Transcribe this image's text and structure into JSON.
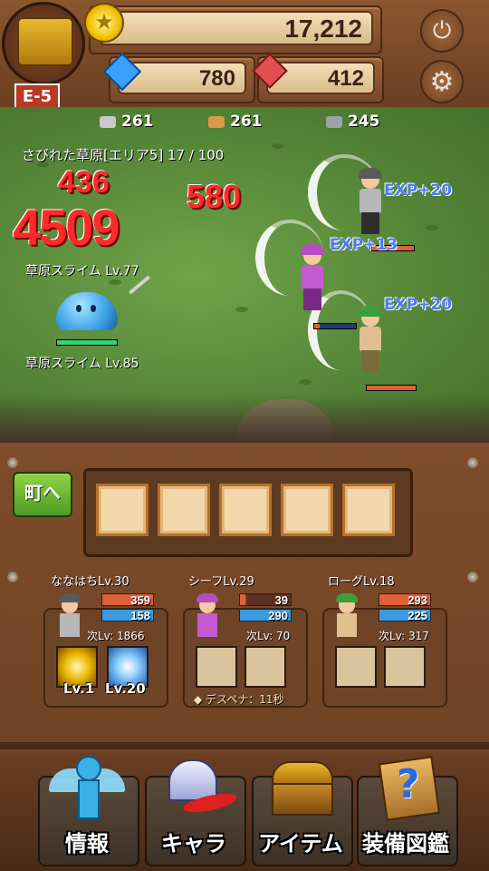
{
  "currency": {
    "gold": "17,212",
    "blue_gem": "780",
    "red_gem": "412"
  },
  "stage": {
    "code": "E-5"
  },
  "materials": [
    {
      "icon": "stone-material-icon",
      "count": "261",
      "color": "#c9c9c9"
    },
    {
      "icon": "wood-material-icon",
      "count": "261",
      "color": "#d99a4a"
    },
    {
      "icon": "ore-material-icon",
      "count": "245",
      "color": "#9aa3a8"
    }
  ],
  "area": {
    "progress_text": "さびれた草原[エリア5] 17 / 100"
  },
  "battle": {
    "damage_numbers": [
      "436",
      "4509",
      "580"
    ],
    "exp_gains": [
      "EXP+20",
      "EXP+13",
      "EXP+20"
    ],
    "enemies": [
      {
        "label": "草原スライム Lv.77"
      },
      {
        "label": "草原スライム Lv.85"
      }
    ]
  },
  "town_button": {
    "label": "町へ"
  },
  "party": [
    {
      "name": "ななはちLv.30",
      "hp": "359",
      "mp": "158",
      "hp_fill": 1.0,
      "next": "次Lv: 1866",
      "skills": [
        {
          "level": "Lv.1"
        },
        {
          "level": "Lv.20"
        }
      ]
    },
    {
      "name": "シーフLv.29",
      "hp": "39",
      "mp": "290",
      "hp_fill": 0.12,
      "next": "次Lv: 70",
      "status": "デスペナ：11秒"
    },
    {
      "name": "ローグLv.18",
      "hp": "293",
      "mp": "225",
      "hp_fill": 1.0,
      "next": "次Lv: 317"
    }
  ],
  "nav": [
    {
      "label": "情報",
      "icon": "info-angel-icon"
    },
    {
      "label": "キャラ",
      "icon": "helmet-feather-icon"
    },
    {
      "label": "アイテム",
      "icon": "treasure-chest-icon"
    },
    {
      "label": "装備図鑑",
      "icon": "question-book-icon"
    }
  ],
  "colors": {
    "hp": "#e0603a",
    "mp": "#3a9ae0",
    "damage": "#ff2a2a",
    "exp": "#4a78ff"
  }
}
